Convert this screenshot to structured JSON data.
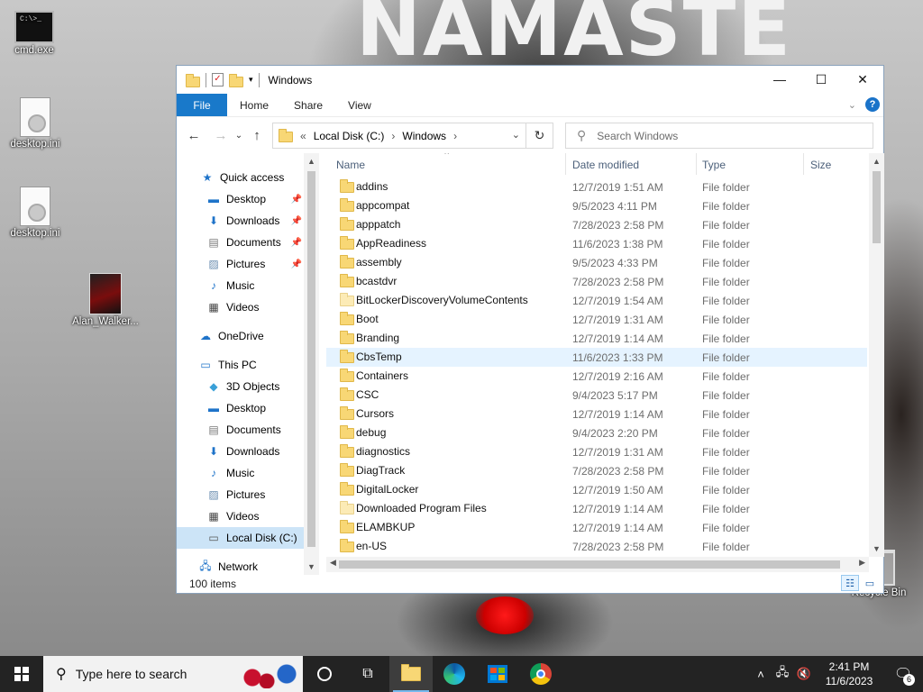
{
  "desktop": {
    "wallpaper_text": "NAMASTE",
    "icons": [
      {
        "label": "cmd.exe",
        "icon": "cmd-icon"
      },
      {
        "label": "desktop.ini",
        "icon": "ini-file-icon"
      },
      {
        "label": "desktop.ini",
        "icon": "ini-file-icon"
      },
      {
        "label": "Alan_Walker...",
        "icon": "image-file-icon"
      },
      {
        "label": "Recycle Bin",
        "icon": "recycle-bin-icon"
      }
    ]
  },
  "window": {
    "title": "Windows",
    "controls": {
      "minimize": "—",
      "maximize": "☐",
      "close": "✕"
    }
  },
  "ribbon": {
    "tabs": [
      "File",
      "Home",
      "Share",
      "View"
    ],
    "help": "?"
  },
  "address": {
    "overflow": "«",
    "crumbs": [
      "Local Disk (C:)",
      "Windows"
    ],
    "separator": "›"
  },
  "search": {
    "placeholder": "Search Windows"
  },
  "nav_pane": {
    "items": [
      {
        "label": "Quick access",
        "icon": "star-icon"
      },
      {
        "label": "Desktop",
        "icon": "desktop-icon",
        "pinned": true
      },
      {
        "label": "Downloads",
        "icon": "download-icon",
        "pinned": true
      },
      {
        "label": "Documents",
        "icon": "documents-icon",
        "pinned": true
      },
      {
        "label": "Pictures",
        "icon": "pictures-icon",
        "pinned": true
      },
      {
        "label": "Music",
        "icon": "music-icon"
      },
      {
        "label": "Videos",
        "icon": "videos-icon"
      },
      {
        "label": "OneDrive",
        "icon": "cloud-icon"
      },
      {
        "label": "This PC",
        "icon": "computer-icon"
      },
      {
        "label": "3D Objects",
        "icon": "cube-icon"
      },
      {
        "label": "Desktop",
        "icon": "desktop-icon"
      },
      {
        "label": "Documents",
        "icon": "documents-icon"
      },
      {
        "label": "Downloads",
        "icon": "download-icon"
      },
      {
        "label": "Music",
        "icon": "music-icon"
      },
      {
        "label": "Pictures",
        "icon": "pictures-icon"
      },
      {
        "label": "Videos",
        "icon": "videos-icon"
      },
      {
        "label": "Local Disk (C:)",
        "icon": "drive-icon",
        "selected": true
      },
      {
        "label": "Network",
        "icon": "network-icon"
      }
    ]
  },
  "file_list": {
    "columns": [
      "Name",
      "Date modified",
      "Type",
      "Size"
    ],
    "rows": [
      {
        "name": "addins",
        "date": "12/7/2019 1:51 AM",
        "type": "File folder"
      },
      {
        "name": "appcompat",
        "date": "9/5/2023 4:11 PM",
        "type": "File folder"
      },
      {
        "name": "apppatch",
        "date": "7/28/2023 2:58 PM",
        "type": "File folder"
      },
      {
        "name": "AppReadiness",
        "date": "11/6/2023 1:38 PM",
        "type": "File folder"
      },
      {
        "name": "assembly",
        "date": "9/5/2023 4:33 PM",
        "type": "File folder"
      },
      {
        "name": "bcastdvr",
        "date": "7/28/2023 2:58 PM",
        "type": "File folder"
      },
      {
        "name": "BitLockerDiscoveryVolumeContents",
        "date": "12/7/2019 1:54 AM",
        "type": "File folder"
      },
      {
        "name": "Boot",
        "date": "12/7/2019 1:31 AM",
        "type": "File folder"
      },
      {
        "name": "Branding",
        "date": "12/7/2019 1:14 AM",
        "type": "File folder"
      },
      {
        "name": "CbsTemp",
        "date": "11/6/2023 1:33 PM",
        "type": "File folder"
      },
      {
        "name": "Containers",
        "date": "12/7/2019 2:16 AM",
        "type": "File folder"
      },
      {
        "name": "CSC",
        "date": "9/4/2023 5:17 PM",
        "type": "File folder"
      },
      {
        "name": "Cursors",
        "date": "12/7/2019 1:14 AM",
        "type": "File folder"
      },
      {
        "name": "debug",
        "date": "9/4/2023 2:20 PM",
        "type": "File folder"
      },
      {
        "name": "diagnostics",
        "date": "12/7/2019 1:31 AM",
        "type": "File folder"
      },
      {
        "name": "DiagTrack",
        "date": "7/28/2023 2:58 PM",
        "type": "File folder"
      },
      {
        "name": "DigitalLocker",
        "date": "12/7/2019 1:50 AM",
        "type": "File folder"
      },
      {
        "name": "Downloaded Program Files",
        "date": "12/7/2019 1:14 AM",
        "type": "File folder"
      },
      {
        "name": "ELAMBKUP",
        "date": "12/7/2019 1:14 AM",
        "type": "File folder"
      },
      {
        "name": "en-US",
        "date": "7/28/2023 2:58 PM",
        "type": "File folder"
      }
    ]
  },
  "status": {
    "item_count": "100 items"
  },
  "taskbar": {
    "search_placeholder": "Type here to search",
    "apps": [
      "cortana-icon",
      "task-view-icon",
      "file-explorer-icon",
      "edge-icon",
      "store-icon",
      "chrome-icon"
    ],
    "clock_time": "2:41 PM",
    "clock_date": "11/6/2023",
    "notification_count": "6"
  },
  "colors": {
    "accent": "#1979ca",
    "selected_bg": "#cce4f7",
    "hover_bg": "#e5f3ff",
    "folder": "#f8d775",
    "taskbar_bg": "#232323"
  }
}
